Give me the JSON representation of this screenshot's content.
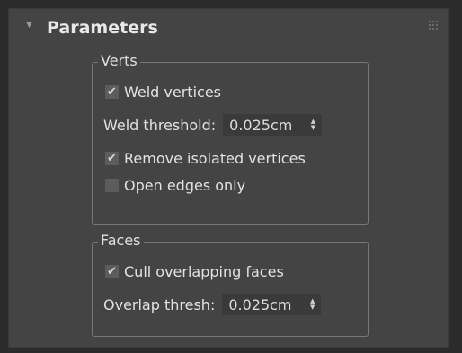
{
  "rollout": {
    "title": "Parameters",
    "collapse_icon": "triangle-down-icon",
    "grip_icon": "drag-grip-icon"
  },
  "verts": {
    "title": "Verts",
    "weld_vertices": {
      "label": "Weld vertices",
      "checked": true
    },
    "weld_threshold": {
      "label": "Weld threshold:",
      "value": "0.025cm"
    },
    "remove_isolated": {
      "label": "Remove isolated vertices",
      "checked": true
    },
    "open_edges_only": {
      "label": "Open edges only",
      "checked": false
    }
  },
  "faces": {
    "title": "Faces",
    "cull_overlapping": {
      "label": "Cull overlapping faces",
      "checked": true
    },
    "overlap_thresh": {
      "label": "Overlap thresh:",
      "value": "0.025cm"
    }
  },
  "colors": {
    "panel": "#444444",
    "background": "#2b2b2b",
    "text": "#e2e2e2"
  }
}
